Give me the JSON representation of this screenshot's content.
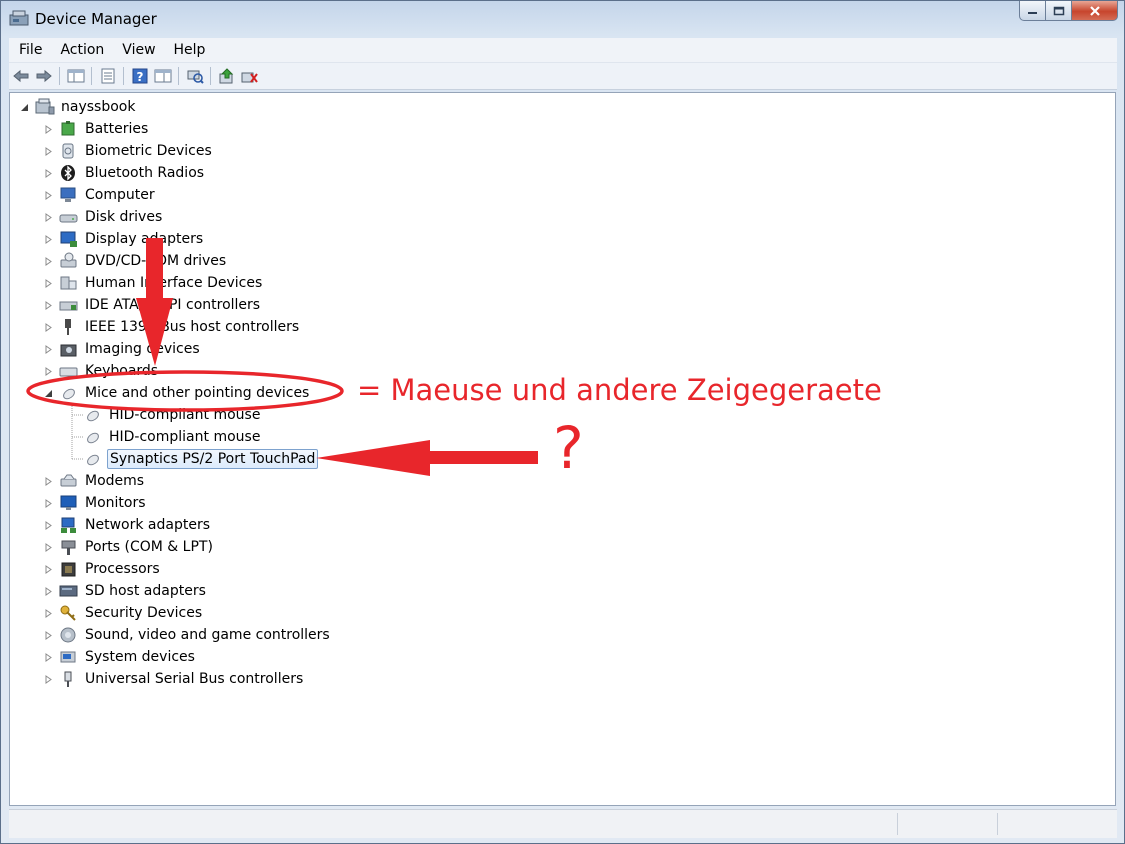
{
  "window": {
    "title": "Device Manager"
  },
  "menu": [
    "File",
    "Action",
    "View",
    "Help"
  ],
  "toolbar": [
    "back-icon",
    "forward-icon",
    "show-hide-tree-icon",
    "properties-icon",
    "help-icon",
    "view-icon",
    "scan-hardware-icon",
    "update-driver-icon",
    "uninstall-icon"
  ],
  "tree": {
    "root": "nayssbook",
    "categories": [
      "Batteries",
      "Biometric Devices",
      "Bluetooth Radios",
      "Computer",
      "Disk drives",
      "Display adapters",
      "DVD/CD-ROM drives",
      "Human Interface Devices",
      "IDE ATA/ATAPI controllers",
      "IEEE 1394 Bus host controllers",
      "Imaging devices",
      "Keyboards",
      "Mice and other pointing devices",
      "Modems",
      "Monitors",
      "Network adapters",
      "Ports (COM & LPT)",
      "Processors",
      "SD host adapters",
      "Security Devices",
      "Sound, video and game controllers",
      "System devices",
      "Universal Serial Bus controllers"
    ],
    "mice_children": [
      "HID-compliant mouse",
      "HID-compliant mouse",
      "Synaptics PS/2 Port TouchPad"
    ]
  },
  "annotations": {
    "translation": "= Maeuse und andere Zeigegeraete",
    "question": "?"
  },
  "colors": {
    "annotation": "#e8262b",
    "selection": "#dcebfc"
  }
}
